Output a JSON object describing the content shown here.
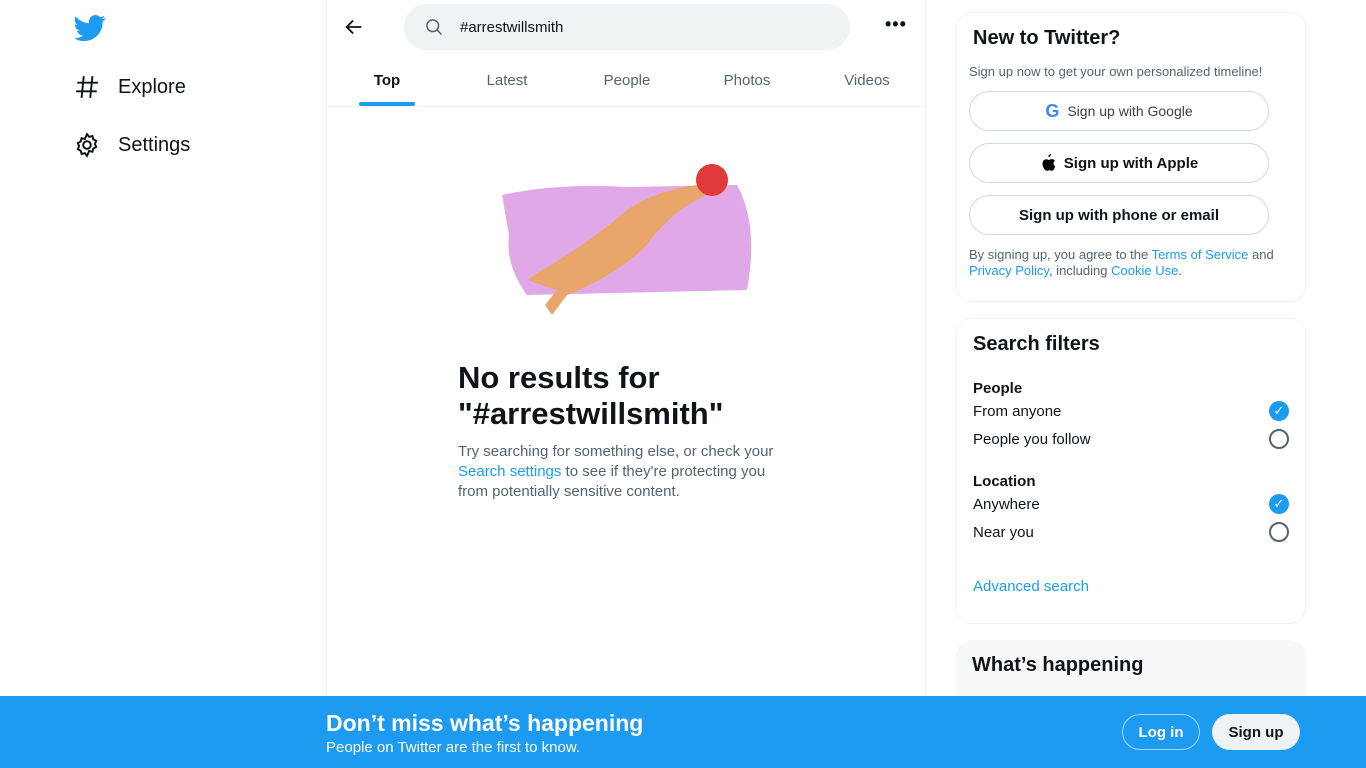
{
  "nav": {
    "items": [
      {
        "label": "Explore",
        "icon": "hashtag-icon"
      },
      {
        "label": "Settings",
        "icon": "gear-icon"
      }
    ]
  },
  "search": {
    "value": "#arrestwillsmith"
  },
  "tabs": [
    {
      "label": "Top",
      "active": true
    },
    {
      "label": "Latest"
    },
    {
      "label": "People"
    },
    {
      "label": "Photos"
    },
    {
      "label": "Videos"
    }
  ],
  "empty": {
    "title_line1": "No results for",
    "title_line2": "\"#arrestwillsmith\"",
    "text_before": "Try searching for something else, or check your ",
    "link": "Search settings",
    "text_after": " to see if they're protecting you from potentially sensitive content."
  },
  "signup_card": {
    "title": "New to Twitter?",
    "subtitle": "Sign up now to get your own personalized timeline!",
    "google": "Sign up with Google",
    "apple": "Sign up with Apple",
    "phone": "Sign up with phone or email",
    "terms_1": "By signing up, you agree to the ",
    "terms_link": "Terms of Service",
    "terms_2": " and ",
    "privacy_link": "Privacy Policy",
    "terms_3": ", including ",
    "cookie_link": "Cookie Use",
    "terms_4": "."
  },
  "filters": {
    "title": "Search filters",
    "people_heading": "People",
    "people_options": [
      {
        "label": "From anyone",
        "checked": true
      },
      {
        "label": "People you follow",
        "checked": false
      }
    ],
    "location_heading": "Location",
    "location_options": [
      {
        "label": "Anywhere",
        "checked": true
      },
      {
        "label": "Near you",
        "checked": false
      }
    ],
    "advanced": "Advanced search"
  },
  "happening": {
    "title": "What’s happening"
  },
  "banner": {
    "title": "Don’t miss what’s happening",
    "subtitle": "People on Twitter are the first to know.",
    "login": "Log in",
    "signup": "Sign up"
  },
  "colors": {
    "accent": "#1d9bf0",
    "text": "#0f1419",
    "muted": "#536471"
  }
}
